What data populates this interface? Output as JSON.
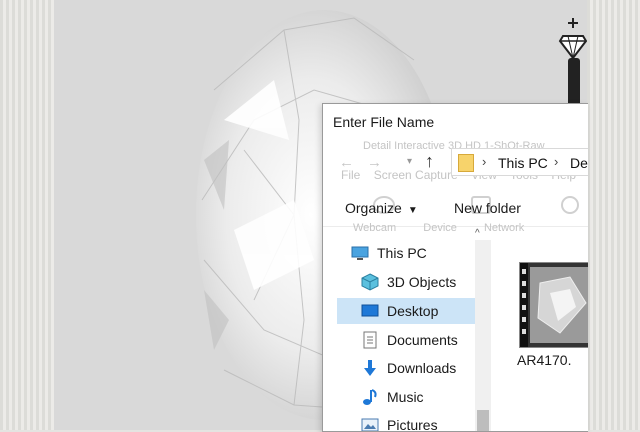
{
  "dialog": {
    "title": "Enter File Name",
    "ghost_caption": "Detail Interactive 3D HD 1-ShOt-Raw",
    "ghost_menu": [
      "File",
      "Screen Capture",
      "View",
      "Tools",
      "Help"
    ],
    "ghost_toolbar": [
      "Webcam",
      "Device",
      "Network"
    ],
    "address": {
      "crumbs": [
        "This PC",
        "De"
      ]
    },
    "command_bar": {
      "organize_label": "Organize",
      "new_folder_label": "New folder"
    },
    "nav_items": [
      {
        "label": "This PC",
        "icon": "computer-icon",
        "selected": false
      },
      {
        "label": "3D Objects",
        "icon": "cube-icon",
        "selected": false
      },
      {
        "label": "Desktop",
        "icon": "desktop-icon",
        "selected": true
      },
      {
        "label": "Documents",
        "icon": "document-icon",
        "selected": false
      },
      {
        "label": "Downloads",
        "icon": "download-icon",
        "selected": false
      },
      {
        "label": "Music",
        "icon": "music-icon",
        "selected": false
      },
      {
        "label": "Pictures",
        "icon": "pictures-icon",
        "selected": false
      }
    ],
    "content": {
      "file_label": "AR4170."
    }
  },
  "colors": {
    "selection": "#cce4f7",
    "folder": "#f7d36b",
    "accent_blue": "#1e88e5"
  }
}
